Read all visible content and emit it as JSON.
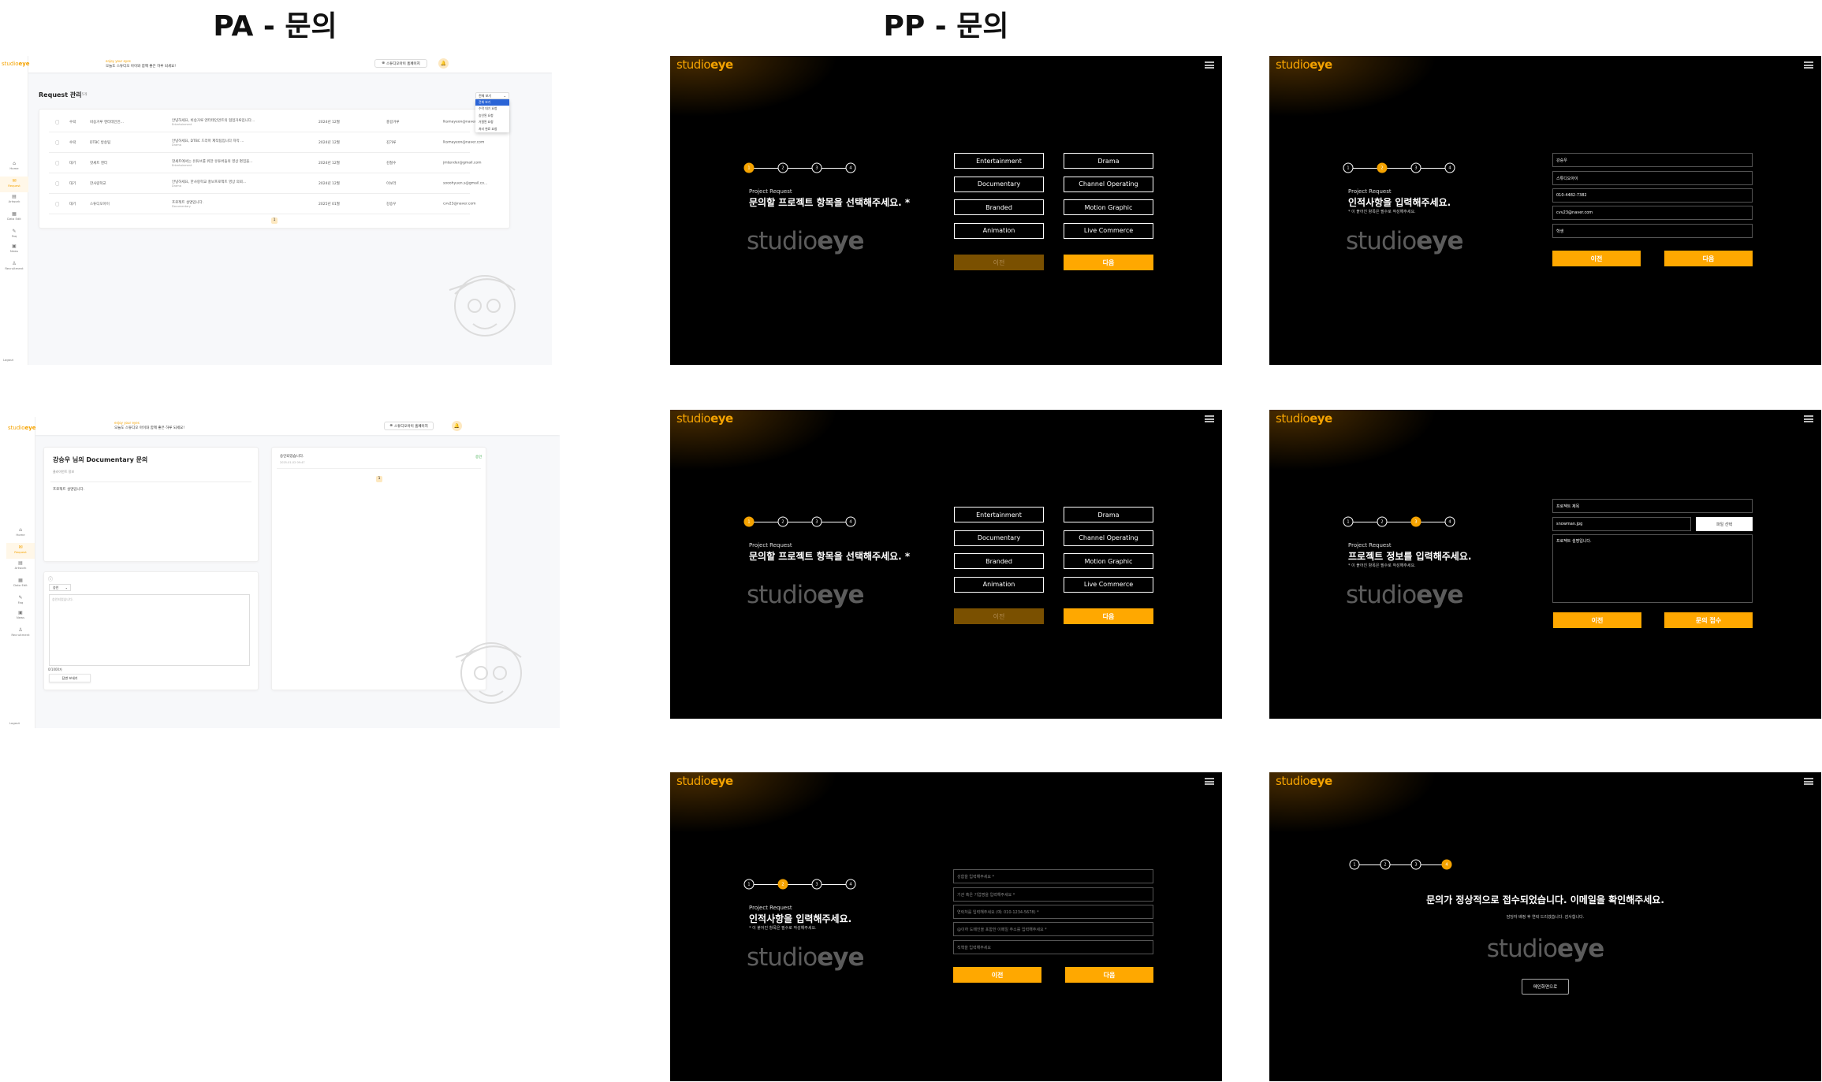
{
  "titles": {
    "pa": "PA - 문의",
    "pp": "PP - 문의"
  },
  "admin": {
    "logo_a": "studio",
    "logo_b": "eye",
    "tagline": "enjoy your eyes",
    "greeting": "오늘도 스튜디오 아이와 함께 좋은 하루 되세요!",
    "homepage_button": "스튜디오아이 홈페이지",
    "sidebar": [
      {
        "label": "Home",
        "icon": "⌂"
      },
      {
        "label": "Request",
        "icon": "✉"
      },
      {
        "label": "Artwork",
        "icon": "▤"
      },
      {
        "label": "Data Edit",
        "icon": "▦"
      },
      {
        "label": "Faq",
        "icon": "✎"
      },
      {
        "label": "News",
        "icon": "▣"
      },
      {
        "label": "Recruitment",
        "icon": "♙"
      }
    ],
    "logout": "Logout",
    "list": {
      "title": "Request 관리",
      "count": "총 5개",
      "filter": {
        "selected": "전체 보기",
        "options": [
          "전체 보기",
          "수락 대기 요청",
          "승인된 요청",
          "거절된 요청",
          "처리 완료 요청"
        ]
      },
      "rows": [
        {
          "status": "수락",
          "title": "비승거루 엔터테인먼...",
          "desc": "안녕하세요, 비승거루 엔터테인먼트의 협업거루입니다...",
          "category": "Entertainment",
          "date": "2024년 12월",
          "name": "홍길거루",
          "email": "lksmayeon@naver.com"
        },
        {
          "status": "수락",
          "title": "DTBC 방송팀",
          "desc": "안녕하세요, DTBC 드라마 제작팀입니다 자막 ...",
          "category": "Drama",
          "date": "2024년 12월",
          "name": "김가루",
          "email": "lksmayeon@naver.com"
        },
        {
          "status": "대기",
          "title": "핫셰트 엔터",
          "desc": "핫셰트에서는 유튜브를 위한 유튜버들의 영상 편집을...",
          "category": "Entertainment",
          "date": "2024년 12월",
          "name": "김철수",
          "email": "jmtender@gmail.com"
        },
        {
          "status": "대기",
          "title": "한사랑학교",
          "desc": "안녕하세요, 한사랑학교 홍보프로젝트 영상 의뢰...",
          "category": "Drama",
          "date": "2024년 12월",
          "name": "이보라",
          "email": "sooohyuen.s@gmail.co..."
        },
        {
          "status": "대기",
          "title": "스튜디오아이",
          "desc": "프로젝트 설명입니다.",
          "category": "Documentary",
          "date": "2025년 01월",
          "name": "강승우",
          "email": "cvv23@naver.com"
        }
      ],
      "page": "1"
    },
    "detail": {
      "title": "강승우 님의 Documentary 문의",
      "subtitle": "클라이언트 정보",
      "content": "프로젝트 설명입니다.",
      "status_select": "승인",
      "reply_placeholder": "승인되었습니다.",
      "char_count": "0/1000자",
      "send_button": "답변 보내기",
      "history": [
        {
          "text": "승인되었습니다.",
          "date": "2025-01-02 09:47",
          "badge": "승인"
        }
      ],
      "page": "1",
      "badge_color": "#3bab4a"
    },
    "watermark": "Studioeye"
  },
  "pp": {
    "logo_a": "studio",
    "logo_b": "eye",
    "accent": "#ffa800",
    "steps": [
      "1",
      "2",
      "3",
      "4"
    ],
    "screens": [
      {
        "type": "select",
        "active": 1,
        "kicker": "Project Request",
        "heading": "문의할 프로젝트 항목을 선택해주세요. *",
        "options": [
          "Entertainment",
          "Drama",
          "Documentary",
          "Channel Operating",
          "Branded",
          "Motion Graphic",
          "Animation",
          "Live Commerce"
        ],
        "prev": "이전",
        "next": "다음",
        "prev_disabled": true
      },
      {
        "type": "form",
        "active": 2,
        "kicker": "Project Request",
        "heading": "인적사항을 입력해주세요.",
        "note": "* 이 붙어진 항목은 필수로 작성해주세요.",
        "fields": [
          {
            "value": "강승우"
          },
          {
            "value": "스튜디오아이"
          },
          {
            "value": "010-4482-7382"
          },
          {
            "value": "cvv23@naver.com"
          },
          {
            "value": "학생"
          }
        ],
        "prev": "이전",
        "next": "다음"
      },
      {
        "type": "select",
        "active": 1,
        "kicker": "Project Request",
        "heading": "문의할 프로젝트 항목을 선택해주세요. *",
        "options": [
          "Entertainment",
          "Drama",
          "Documentary",
          "Channel Operating",
          "Branded",
          "Motion Graphic",
          "Animation",
          "Live Commerce"
        ],
        "prev": "이전",
        "next": "다음",
        "prev_disabled": true
      },
      {
        "type": "project",
        "active": 3,
        "kicker": "Project Request",
        "heading": "프로젝트 정보를 입력해주세요.",
        "note": "* 이 붙어진 항목은 필수로 작성해주세요.",
        "title_value": "프로젝트 제목",
        "file_value": "snowman.jpg",
        "file_button": "파일 선택",
        "desc_value": "프로젝트 설명입니다.",
        "prev": "이전",
        "next": "문의 접수"
      },
      {
        "type": "form",
        "active": 2,
        "kicker": "Project Request",
        "heading": "인적사항을 입력해주세요.",
        "note": "* 이 붙어진 항목은 필수로 작성해주세요.",
        "fields": [
          {
            "placeholder": "성함을 입력해주세요 *"
          },
          {
            "placeholder": "기관 혹은 기업명을 입력해주세요 *"
          },
          {
            "placeholder": "연락처를 입력해주세요 (예: 010-1234-5678) *"
          },
          {
            "placeholder": "@이하 도메인을 포함한 이메일 주소를 입력해주세요 *"
          },
          {
            "placeholder": "직책을 입력해주세요"
          }
        ],
        "prev": "이전",
        "next": "다음"
      },
      {
        "type": "done",
        "active": 4,
        "heading": "문의가 정상적으로 접수되었습니다. 이메일을 확인해주세요.",
        "sub": "담당자 배정 후 연락 드리겠습니다. 감사합니다.",
        "button": "메인화면으로"
      }
    ]
  }
}
